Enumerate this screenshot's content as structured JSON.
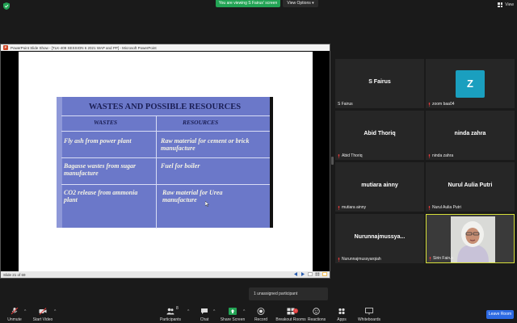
{
  "topbar": {
    "viewing_text": "You are viewing S Fairus' screen",
    "view_options": "View Options ▾",
    "view_button": "View"
  },
  "ppt": {
    "window_title": "PowerPoint Slide Show - [TLK-409 SESSION 6 2021 WAP and PP] - Microsoft PowerPoint",
    "status_text": "Slide 21 of 69",
    "slide": {
      "heading": "WASTES AND POSSIBLE RESOURCES",
      "col_wastes": "WASTES",
      "col_resources": "RESOURCES",
      "rows": [
        {
          "waste": "Fly ash from power plant",
          "resource": "Raw material for cement or brick manufacture"
        },
        {
          "waste": "Bagasse wastes from sugar manufacture",
          "resource": "Fuel for boiler"
        },
        {
          "waste": "CO2 release from ammonia plant",
          "resource": "Raw material for Urea manufacture"
        }
      ]
    }
  },
  "participants": [
    {
      "name": "S Fairus",
      "label": "S Fairus",
      "muted": false
    },
    {
      "name": "",
      "label": "zoom baa04",
      "avatar_letter": "Z",
      "avatar_color": "#1a9fbf",
      "muted": true
    },
    {
      "name": "Abid Thoriq",
      "label": "Abid Thoriq",
      "muted": true
    },
    {
      "name": "ninda zahra",
      "label": "ninda zahra",
      "muted": true
    },
    {
      "name": "mutiara ainny",
      "label": "mutiara ainny",
      "muted": true
    },
    {
      "name": "Nurul Aulia Putri",
      "label": "Nurul Aulia Putri",
      "muted": true
    },
    {
      "name": "Nurunnajmussya...",
      "label": "Nurunnajmussyarqiah",
      "muted": true
    },
    {
      "name": "",
      "label": "Sirin Fairus",
      "muted": true,
      "video": true
    }
  ],
  "notification": "1 unassigned participant",
  "toolbar": {
    "unmute": "Unmute",
    "start_video": "Start Video",
    "participants": "Participants",
    "participants_count": "8",
    "chat": "Chat",
    "share_screen": "Share Screen",
    "record": "Record",
    "breakout_rooms": "Breakout Rooms",
    "reactions": "Reactions",
    "apps": "Apps",
    "whiteboards": "Whiteboards",
    "leave": "Leave Room"
  },
  "colors": {
    "accent_green": "#23a455",
    "leave_blue": "#2d6ae3",
    "active_speaker": "#d7df3a",
    "slide_blue": "#6b78c9"
  }
}
